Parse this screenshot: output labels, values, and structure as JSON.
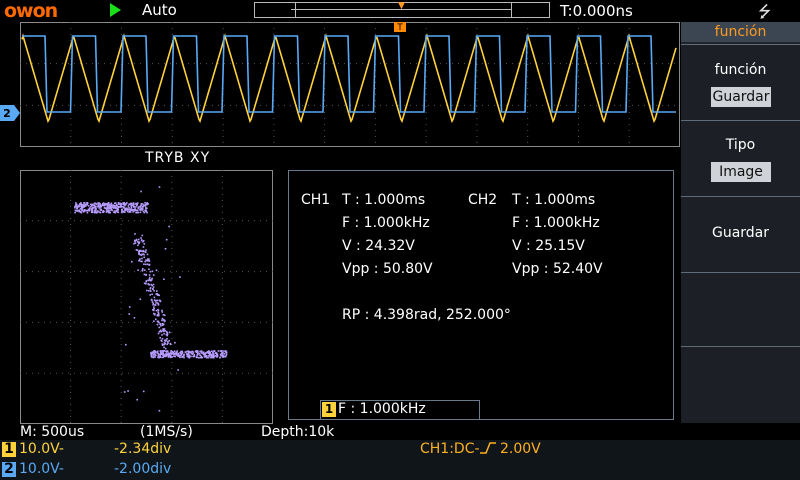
{
  "top": {
    "brand": "owon",
    "run_state": "Auto",
    "time_offset": "T:0.000ns",
    "trigger_marker": "T"
  },
  "waveform": {
    "ch1_color": "#ffd23c",
    "ch2_color": "#59a9f5",
    "xy_color": "#b79cff"
  },
  "xy": {
    "label": "TRYB XY"
  },
  "measurements": {
    "ch1": {
      "name": "CH1",
      "T": "T : 1.000ms",
      "F": "F : 1.000kHz",
      "V": "V : 24.32V",
      "Vpp": "Vpp : 50.80V"
    },
    "ch2": {
      "name": "CH2",
      "T": "T : 1.000ms",
      "F": "F : 1.000kHz",
      "V": "V : 25.15V",
      "Vpp": "Vpp : 52.40V"
    },
    "rp": "RP : 4.398rad, 252.000°"
  },
  "freq_counter": {
    "channel": "1",
    "value": "F : 1.000kHz"
  },
  "menu": {
    "title": "función",
    "items": [
      {
        "label": "función",
        "value": "Guardar"
      },
      {
        "label": "Tipo",
        "value": "Image"
      },
      {
        "label": "Guardar",
        "value": ""
      }
    ]
  },
  "status": {
    "timebase": "M: 500us",
    "sample_rate": "(1MS/s)",
    "depth": "Depth:10k"
  },
  "channels": [
    {
      "num": "1",
      "volts": "10.0V-",
      "offset": "-2.34div",
      "color": "#ffd23c"
    },
    {
      "num": "2",
      "volts": "10.0V-",
      "offset": "-2.00div",
      "color": "#59a9f5"
    }
  ],
  "trigger": {
    "text": "CH1:DC- _  2.00V",
    "color": "#ffb020"
  }
}
